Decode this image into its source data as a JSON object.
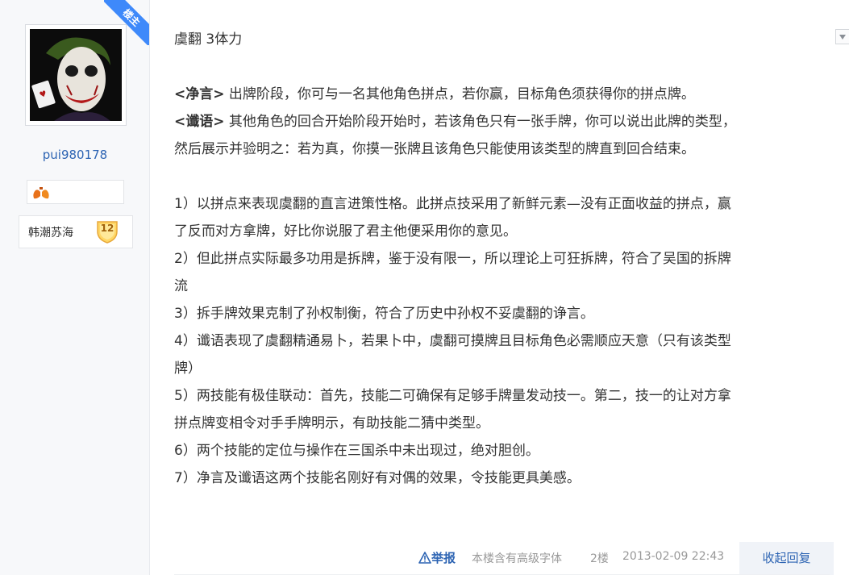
{
  "ribbon": "楼主",
  "user": {
    "name": "pui980178",
    "badge_name": "韩潮苏海",
    "level": "12"
  },
  "post": {
    "lines": [
      {
        "text": "虞翻 3体力",
        "bold": ""
      },
      {
        "text": "",
        "bold": ""
      },
      {
        "bold": "<净言>",
        "text": " 出牌阶段，你可与一名其他角色拼点，若你赢，目标角色须获得你的拼点牌。"
      },
      {
        "bold": "<谶语>",
        "text": " 其他角色的回合开始阶段开始时，若该角色只有一张手牌，你可以说出此牌的类型，"
      },
      {
        "bold": "",
        "text": "然后展示并验明之：若为真，你摸一张牌且该角色只能使用该类型的牌直到回合结束。"
      },
      {
        "text": "",
        "bold": ""
      },
      {
        "bold": "",
        "text": "1）以拼点来表现虞翻的直言进策性格。此拼点技采用了新鲜元素—没有正面收益的拼点，赢"
      },
      {
        "bold": "",
        "text": "了反而对方拿牌，好比你说服了君主他便采用你的意见。"
      },
      {
        "bold": "",
        "text": "2）但此拼点实际最多功用是拆牌，鉴于没有限一，所以理论上可狂拆牌，符合了吴国的拆牌"
      },
      {
        "bold": "",
        "text": "流"
      },
      {
        "bold": "",
        "text": "3）拆手牌效果克制了孙权制衡，符合了历史中孙权不妥虞翻的诤言。"
      },
      {
        "bold": "",
        "text": "4）谶语表现了虞翻精通易卜，若果卜中，虞翻可摸牌且目标角色必需顺应天意（只有该类型"
      },
      {
        "bold": "",
        "text": "牌）"
      },
      {
        "bold": "",
        "text": "5）两技能有极佳联动：首先，技能二可确保有足够手牌量发动技一。第二，技一的让对方拿"
      },
      {
        "bold": "",
        "text": "拼点牌变相令对手手牌明示，有助技能二猜中类型。"
      },
      {
        "bold": "",
        "text": "6）两个技能的定位与操作在三国杀中未出现过，绝对胆创。"
      },
      {
        "bold": "",
        "text": "7）净言及谶语这两个技能名刚好有对偶的效果，令技能更具美感。"
      }
    ]
  },
  "footer": {
    "report": "举报",
    "font_note": "本楼含有高级字体",
    "floor": "2楼",
    "timestamp": "2013-02-09 22:43",
    "reply": "收起回复"
  },
  "colors": {
    "accent": "#2d64b3",
    "ribbon": "#3e89fa"
  }
}
